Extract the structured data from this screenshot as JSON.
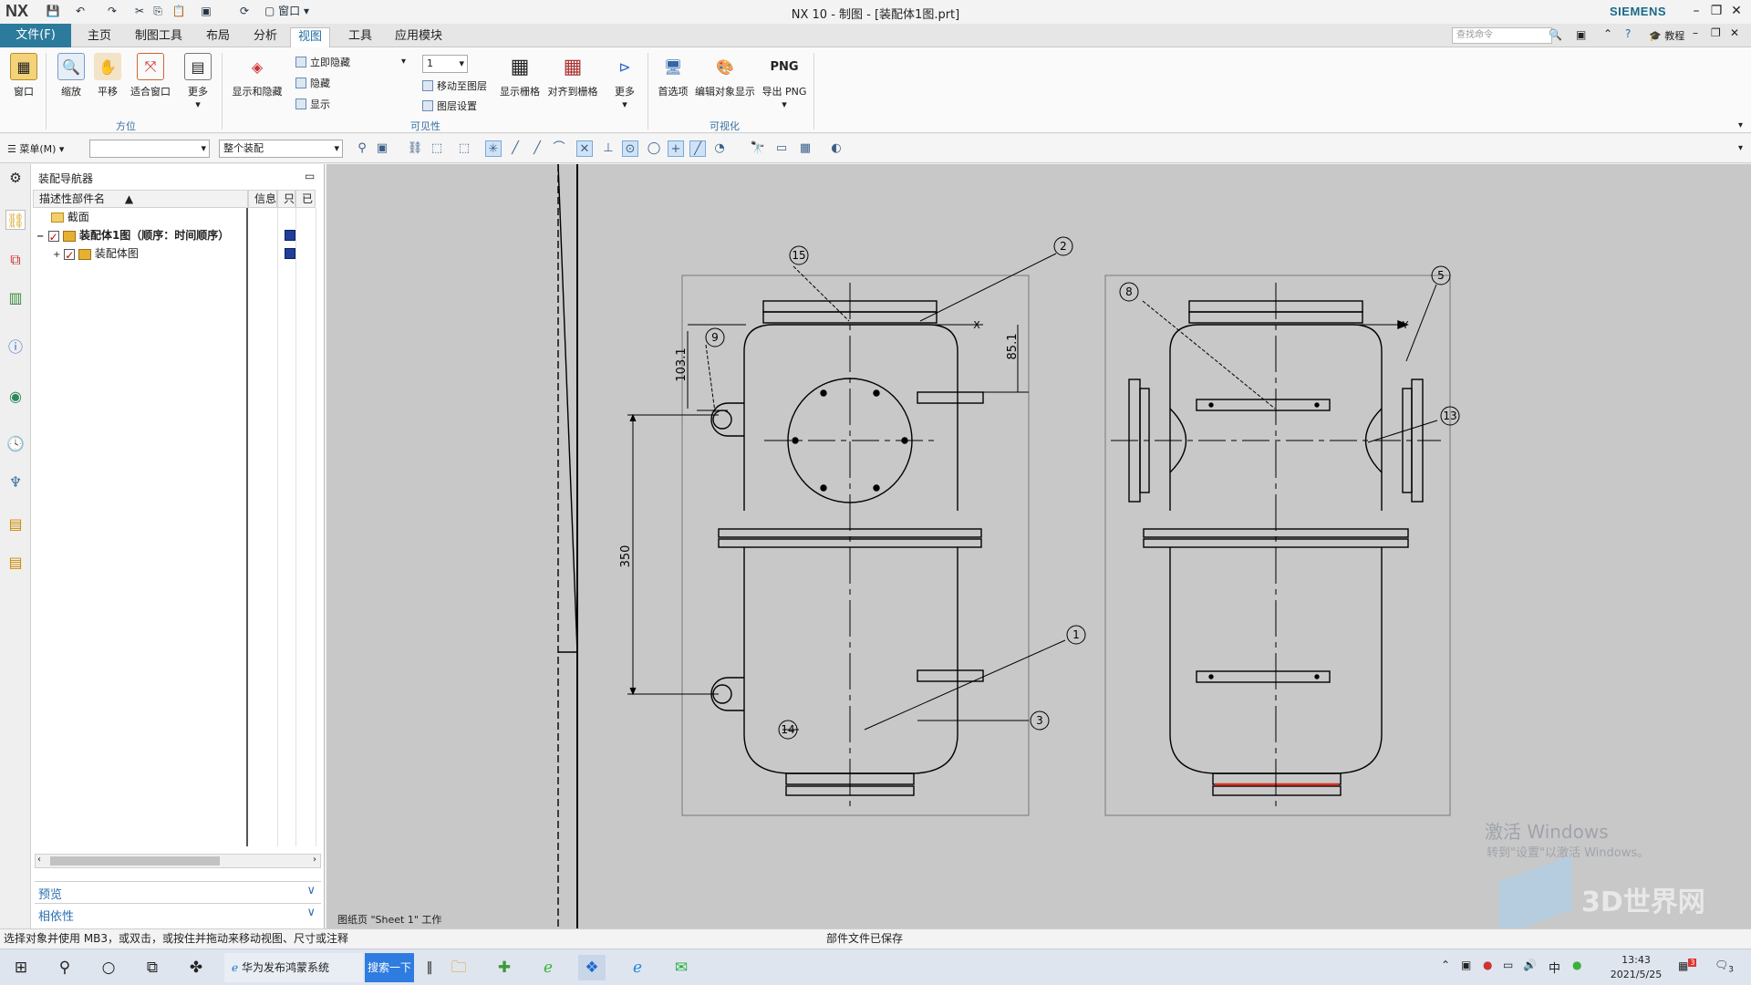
{
  "app": {
    "logo": "NX",
    "title": "NX 10 - 制图 - [装配体1图.prt]",
    "brand": "SIEMENS",
    "window_menu": "窗口"
  },
  "menu": {
    "file": "文件(F)",
    "tabs": [
      "主页",
      "制图工具",
      "布局",
      "分析",
      "视图",
      "工具",
      "应用模块"
    ],
    "active": "视图",
    "search_placeholder": "查找命令",
    "help": "教程"
  },
  "ribbon": {
    "groups": {
      "orient": "方位",
      "visibility": "可见性",
      "visualize": "可视化"
    },
    "buttons": {
      "window": "窗口",
      "zoom": "缩放",
      "pan": "平移",
      "fit": "适合窗口",
      "more1": "更多",
      "show_hide": "显示和隐藏",
      "immediate_hide": "立即隐藏",
      "hide": "隐藏",
      "show": "显示",
      "layer_value": "1",
      "move_layer": "移动至图层",
      "layer_settings": "图层设置",
      "show_grid": "显示栅格",
      "snap_grid": "对齐到栅格",
      "more2": "更多",
      "prefs": "首选项",
      "edit_display": "编辑对象显示",
      "png_label": "PNG",
      "export_png": "导出 PNG"
    }
  },
  "toolbar": {
    "menu": "菜单(M)",
    "filter_value": "",
    "scope_value": "整个装配"
  },
  "navigator": {
    "title": "装配导航器",
    "columns": {
      "name": "描述性部件名",
      "info": "信息",
      "readonly": "只",
      "modified": "已"
    },
    "rows": [
      {
        "label": "截面"
      },
      {
        "label": "装配体1图（顺序：时间顺序）"
      },
      {
        "label": "装配体图"
      }
    ],
    "accordion": {
      "preview": "预览",
      "dependency": "相依性"
    }
  },
  "drawing": {
    "sheet_label": "图纸页 \"Sheet 1\" 工作",
    "balloons": [
      "15",
      "2",
      "9",
      "1",
      "3",
      "14",
      "8",
      "5",
      "13"
    ],
    "dims": {
      "d1": "103.1",
      "d2": "85.1",
      "d3": "350"
    },
    "axis_x": "X",
    "axis_y": "Y",
    "watermark1": "激活 Windows",
    "watermark2": "转到\"设置\"以激活 Windows。",
    "brand_wm": "3D世界网"
  },
  "status": {
    "hint": "选择对象并使用 MB3，或双击，或按住并拖动来移动视图、尺寸或注释",
    "message": "部件文件已保存"
  },
  "taskbar": {
    "search_tab": "华为发布鸿蒙系统",
    "search_btn": "搜索一下",
    "ime": "中",
    "time": "13:43",
    "date": "2021/5/25",
    "notif_count": "3",
    "badge": "3"
  },
  "colors": {
    "accent": "#2c7a9c",
    "canvas": "#c8c8c8",
    "highlight": "#e03020"
  }
}
